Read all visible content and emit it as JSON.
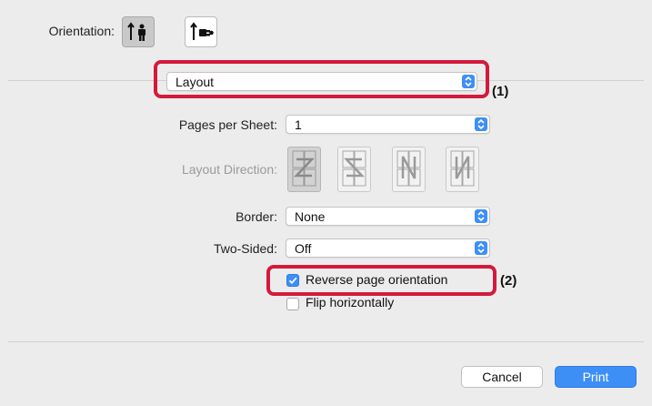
{
  "orientation": {
    "label": "Orientation:",
    "options": [
      {
        "name": "portrait",
        "selected": true
      },
      {
        "name": "landscape",
        "selected": false
      }
    ]
  },
  "section_popup": {
    "value": "Layout"
  },
  "pages_per_sheet": {
    "label": "Pages per Sheet:",
    "value": "1"
  },
  "layout_direction": {
    "label": "Layout Direction:",
    "enabled": false,
    "options": [
      "z-shape",
      "reverse-z-shape",
      "reverse-n-shape",
      "n-shape"
    ],
    "selected_index": 0
  },
  "border": {
    "label": "Border:",
    "value": "None"
  },
  "two_sided": {
    "label": "Two-Sided:",
    "value": "Off"
  },
  "reverse_orientation": {
    "label": "Reverse page orientation",
    "checked": true
  },
  "flip_horizontally": {
    "label": "Flip horizontally",
    "checked": false
  },
  "callouts": {
    "one": "(1)",
    "two": "(2)"
  },
  "footer": {
    "cancel_label": "Cancel",
    "print_label": "Print"
  },
  "colors": {
    "accent": "#3d8ff6",
    "highlight": "#d41a3c",
    "window_bg": "#ececec"
  }
}
